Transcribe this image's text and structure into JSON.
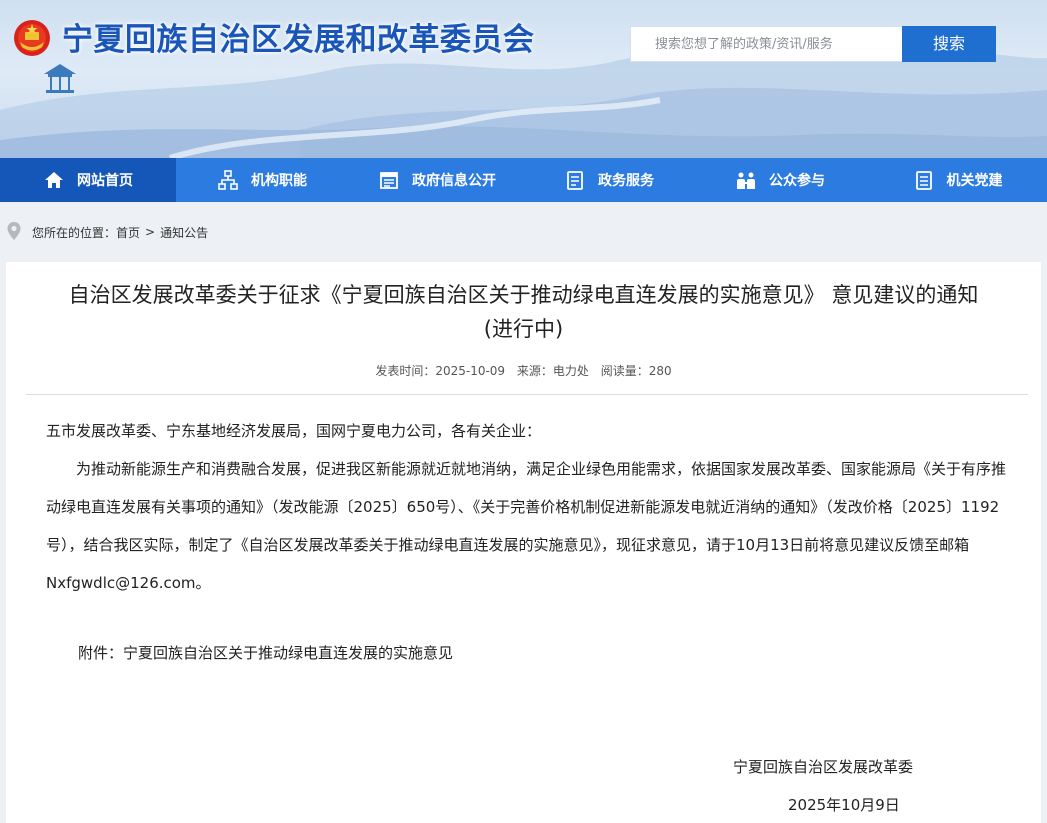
{
  "header": {
    "site_title": "宁夏回族自治区发展和改革委员会",
    "search_placeholder": "搜索您想了解的政策/资讯/服务",
    "search_button": "搜索"
  },
  "nav": {
    "items": [
      {
        "label": "网站首页",
        "icon": "home-icon"
      },
      {
        "label": "机构职能",
        "icon": "org-chart-icon"
      },
      {
        "label": "政府信息公开",
        "icon": "calendar-list-icon"
      },
      {
        "label": "政务服务",
        "icon": "document-icon"
      },
      {
        "label": "公众参与",
        "icon": "people-icon"
      },
      {
        "label": "机关党建",
        "icon": "clipboard-icon"
      }
    ]
  },
  "breadcrumb": {
    "prefix": "您所在的位置：",
    "home": "首页",
    "separator": ">",
    "current": "通知公告"
  },
  "article": {
    "title_line1": "自治区发展改革委关于征求《宁夏回族自治区关于推动绿电直连发展的实施意见》 意见建议的通知",
    "title_line2": "(进行中)",
    "meta_time": "发表时间：2025-10-09",
    "meta_source": "来源：电力处",
    "meta_views": "阅读量：280",
    "salutation": "五市发展改革委、宁东基地经济发展局，国网宁夏电力公司，各有关企业：",
    "paragraph": "为推动新能源生产和消费融合发展，促进我区新能源就近就地消纳，满足企业绿色用能需求，依据国家发展改革委、国家能源局《关于有序推动绿电直连发展有关事项的通知》（发改能源〔2025〕650号）、《关于完善价格机制促进新能源发电就近消纳的通知》（发改价格〔2025〕1192号），结合我区实际，制定了《自治区发展改革委关于推动绿电直连发展的实施意见》，现征求意见，请于10月13日前将意见建议反馈至邮箱Nxfgwdlc@126.com。",
    "attachment": "附件：宁夏回族自治区关于推动绿电直连发展的实施意见",
    "sign_org": "宁夏回族自治区发展改革委",
    "sign_date": "2025年10月9日"
  },
  "colors": {
    "nav_bg": "#2c7be0",
    "nav_active": "#1457b8",
    "title_blue": "#1a56b8",
    "search_btn": "#1f6fd1"
  }
}
